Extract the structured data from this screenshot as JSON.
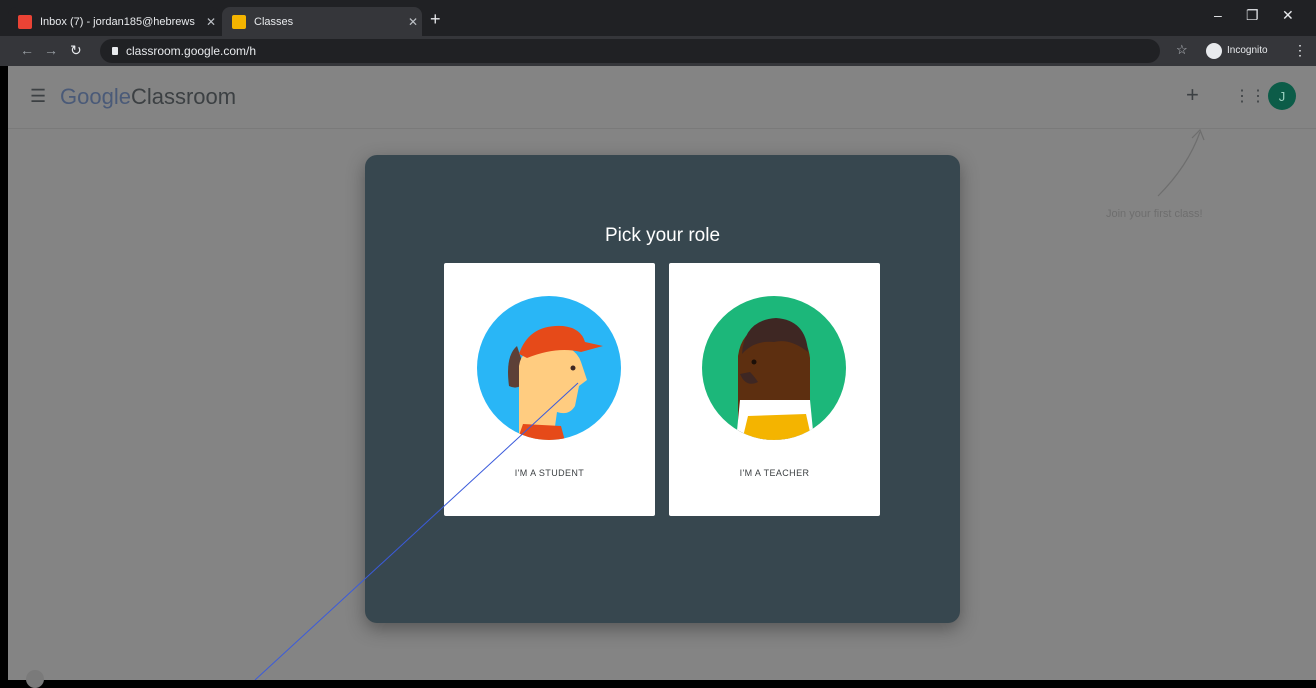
{
  "browser": {
    "tabs": [
      {
        "title": "Inbox (7) - jordan185@hebrews",
        "favicon_color": "#ea4335"
      },
      {
        "title": "Classes",
        "favicon_color": "#f4b400"
      }
    ],
    "url": "classroom.google.com/h",
    "profile_label": "Incognito"
  },
  "header": {
    "brand_google": "Google",
    "brand_product": "Classroom",
    "avatar_initial": "J"
  },
  "hint_text": "Join your first class!",
  "dialog": {
    "title": "Pick your role",
    "roles": [
      {
        "label": "I'M A STUDENT",
        "circle_color": "#29b6f6"
      },
      {
        "label": "I'M A TEACHER",
        "circle_color": "#1cb77a"
      }
    ]
  },
  "colors": {
    "dialog_bg": "#37474f",
    "dim_overlay": "#848484",
    "annotation_line": "#3b5bdb"
  }
}
